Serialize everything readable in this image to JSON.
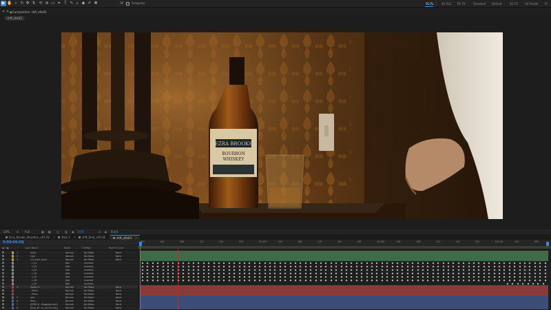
{
  "toolbar": {
    "snapping_label": "Snapping",
    "workspaces": [
      "SG RL",
      "SG RL2",
      "RV FX",
      "Standard",
      "Default",
      "SG FX",
      "All Panels",
      "Pr"
    ],
    "active_workspace": "SG RL"
  },
  "composition": {
    "panel_title": "Composition: shft_v0e03",
    "chip": "shft_v0e03"
  },
  "viewer_footer": {
    "zoom": "50%",
    "resolution": "Full",
    "timecode_short": "0:00",
    "camera": "0,0,0"
  },
  "timeline": {
    "tabs": [
      {
        "label": "Ezra_Brooks_Bourbon_v03.02"
      },
      {
        "label": "Shot 1"
      },
      {
        "label": "shft_Shot_v03.02"
      },
      {
        "label": "shft_v0e03",
        "active": true
      }
    ],
    "timecode": "0:00:00:00",
    "columns": {
      "layer_name": "Layer Name",
      "mode": "Mode",
      "trkmat": "T  TrkMat",
      "parent": "Parent & Link"
    },
    "ruler_labels": [
      "00f",
      "04f",
      "08f",
      "12f",
      "16f",
      "20f",
      "01:00f",
      "04f",
      "08f",
      "12f",
      "16f",
      "20f",
      "02:00f",
      "04f",
      "08f",
      "12f",
      "16f",
      "20f",
      "03:00f",
      "04f",
      "08f"
    ],
    "layers": [
      {
        "num": "1",
        "name": "Solid",
        "mode": "Normal",
        "trkmat": "No Matte",
        "parent": "None",
        "color": "#c0a030"
      },
      {
        "num": "2",
        "name": "Cam",
        "mode": "Normal",
        "trkmat": "No Matte",
        "parent": "None",
        "color": "#c0a030"
      },
      {
        "num": "3",
        "name": "[1] mask_hand",
        "mode": "Normal",
        "trkmat": "No Matte",
        "parent": "None",
        "color": "#c0a030"
      },
      {
        "num": "",
        "name": "c_01",
        "mode": "Add",
        "trkmat": "Inverted",
        "parent": "",
        "color": "#888"
      },
      {
        "num": "",
        "name": "c_02",
        "mode": "Add",
        "trkmat": "Inverted",
        "parent": "",
        "color": "#888"
      },
      {
        "num": "",
        "name": "c_03",
        "mode": "Add",
        "trkmat": "Inverted",
        "parent": "",
        "color": "#888"
      },
      {
        "num": "",
        "name": "c_04",
        "mode": "Add",
        "trkmat": "Inverted",
        "parent": "",
        "color": "#888"
      },
      {
        "num": "",
        "name": "c_05",
        "mode": "Add",
        "trkmat": "Inverted",
        "parent": "",
        "color": "#888"
      },
      {
        "num": "",
        "name": "c_06",
        "mode": "Add",
        "trkmat": "Inverted",
        "parent": "",
        "color": "#888"
      },
      {
        "num": "",
        "name": "c_07",
        "mode": "Add",
        "trkmat": "Inverted",
        "parent": "",
        "color": "#888"
      },
      {
        "num": "4",
        "name": "Switch 2",
        "mode": "Normal",
        "trkmat": "No Matte",
        "parent": "None",
        "color": "#b03a3a"
      },
      {
        "num": "",
        "name": "Patch",
        "mode": "Normal",
        "trkmat": "No Matte",
        "parent": "None",
        "color": "#b03a3a"
      },
      {
        "num": "",
        "name": "Patch",
        "mode": "Normal",
        "trkmat": "No Matte",
        "parent": "None",
        "color": "#b03a3a"
      },
      {
        "num": "5",
        "name": "bolt",
        "mode": "Normal",
        "trkmat": "No Matte",
        "parent": "None",
        "color": "#4b63a8"
      },
      {
        "num": "6",
        "name": "Whis",
        "mode": "Normal",
        "trkmat": "No Matte",
        "parent": "None",
        "color": "#4b63a8"
      },
      {
        "num": "7",
        "name": "[EZB2 B...Pregrade.mp4]",
        "mode": "Normal",
        "trkmat": "No Matte",
        "parent": "None",
        "color": "#4b63a8"
      },
      {
        "num": "8",
        "name": "[Ezra_Br...m_alt_02.mov]",
        "mode": "Normal",
        "trkmat": "No Matte",
        "parent": "None",
        "color": "#4b63a8"
      }
    ]
  }
}
